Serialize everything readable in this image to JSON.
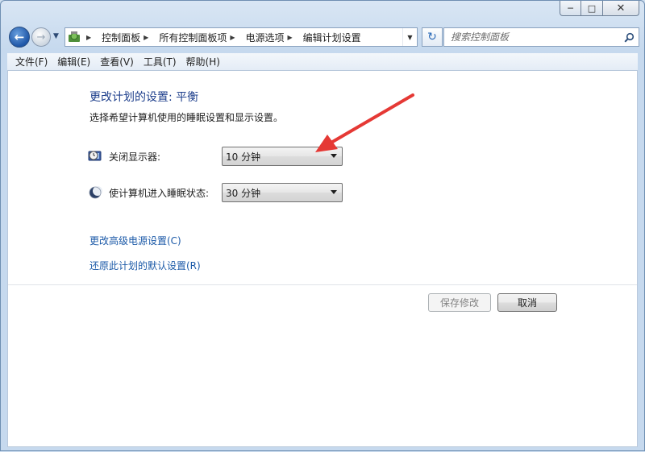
{
  "window": {
    "caption": {
      "minimize": "─",
      "maximize": "□",
      "close": "✕"
    }
  },
  "nav": {
    "back_icon": "back-arrow",
    "forward_icon": "forward-arrow",
    "breadcrumbs": [
      "控制面板",
      "所有控制面板项",
      "电源选项",
      "编辑计划设置"
    ],
    "search_placeholder": "搜索控制面板"
  },
  "menu": [
    "文件(F)",
    "编辑(E)",
    "查看(V)",
    "工具(T)",
    "帮助(H)"
  ],
  "main": {
    "title": "更改计划的设置: 平衡",
    "subtitle": "选择希望计算机使用的睡眠设置和显示设置。",
    "display_off": {
      "label": "关闭显示器:",
      "value": "10 分钟"
    },
    "sleep": {
      "label": "使计算机进入睡眠状态:",
      "value": "30 分钟"
    },
    "links": {
      "advanced": "更改高级电源设置(C)",
      "restore": "还原此计划的默认设置(R)"
    },
    "buttons": {
      "save": "保存修改",
      "cancel": "取消"
    }
  },
  "colors": {
    "annotation_arrow": "#e53935",
    "link": "#1c5aa8",
    "title": "#1e3f8c"
  }
}
